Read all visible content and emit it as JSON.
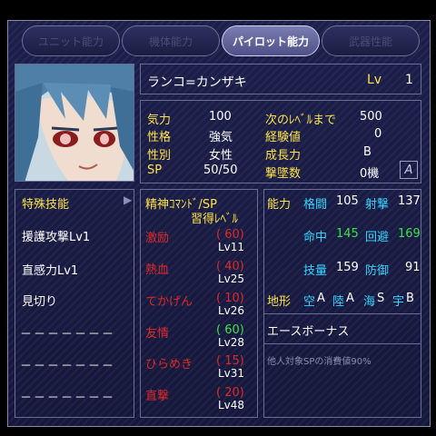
{
  "tabs": [
    {
      "label": "ユニット能力"
    },
    {
      "label": "機体能力"
    },
    {
      "label": "パイロット能力"
    },
    {
      "label": "武器性能"
    }
  ],
  "pilot": {
    "name": "ランコ=カンザキ",
    "lv_label": "Lv",
    "lv_value": "1"
  },
  "stats": {
    "kiryoku_label": "気力",
    "kiryoku_value": "100",
    "seikaku_label": "性格",
    "seikaku_value": "強気",
    "seibetsu_label": "性別",
    "seibetsu_value": "女性",
    "sp_label": "SP",
    "sp_value": "50/50",
    "next_label": "次のﾚﾍﾞﾙまで",
    "next_value": "500",
    "exp_label": "経験値",
    "exp_value": "0",
    "growth_label": "成長力",
    "growth_value": "B",
    "kills_label": "撃墜数",
    "kills_value": "0機",
    "ace_icon": "A"
  },
  "skills": {
    "header": "特殊技能",
    "items": [
      "援護攻撃Lv1",
      "直感力Lv1",
      "見切り",
      "－－－－－－－",
      "－－－－－－－",
      "－－－－－－－"
    ]
  },
  "spirit": {
    "header1": "精神ｺﾏﾝﾄﾞ/SP",
    "header2": "習得ﾚﾍﾞﾙ",
    "commands": [
      {
        "name": "激励",
        "cost": "( 60)",
        "level": "Lv11"
      },
      {
        "name": "熱血",
        "cost": "( 40)",
        "level": "Lv25"
      },
      {
        "name": "てかげん",
        "cost": "( 10)",
        "level": "Lv26"
      },
      {
        "name": "友情",
        "cost": "( 60)",
        "level": "Lv28"
      },
      {
        "name": "ひらめき",
        "cost": "( 15)",
        "level": "Lv31"
      },
      {
        "name": "直撃",
        "cost": "( 20)",
        "level": "Lv48"
      }
    ]
  },
  "abilities": {
    "header": "能力",
    "melee_label": "格闘",
    "melee_value": "105",
    "shoot_label": "射撃",
    "shoot_value": "137",
    "hit_label": "命中",
    "hit_value": "145",
    "evade_label": "回避",
    "evade_value": "169",
    "skill_label": "技量",
    "skill_value": "159",
    "defense_label": "防御",
    "defense_value": "91",
    "terrain_label": "地形",
    "terrain": [
      {
        "label": "空",
        "rank": "A"
      },
      {
        "label": "陸",
        "rank": "A"
      },
      {
        "label": "海",
        "rank": "S"
      },
      {
        "label": "宇",
        "rank": "B"
      }
    ]
  },
  "ace": {
    "header": "エースボーナス",
    "description": "他人対象SPの消費値90%"
  }
}
